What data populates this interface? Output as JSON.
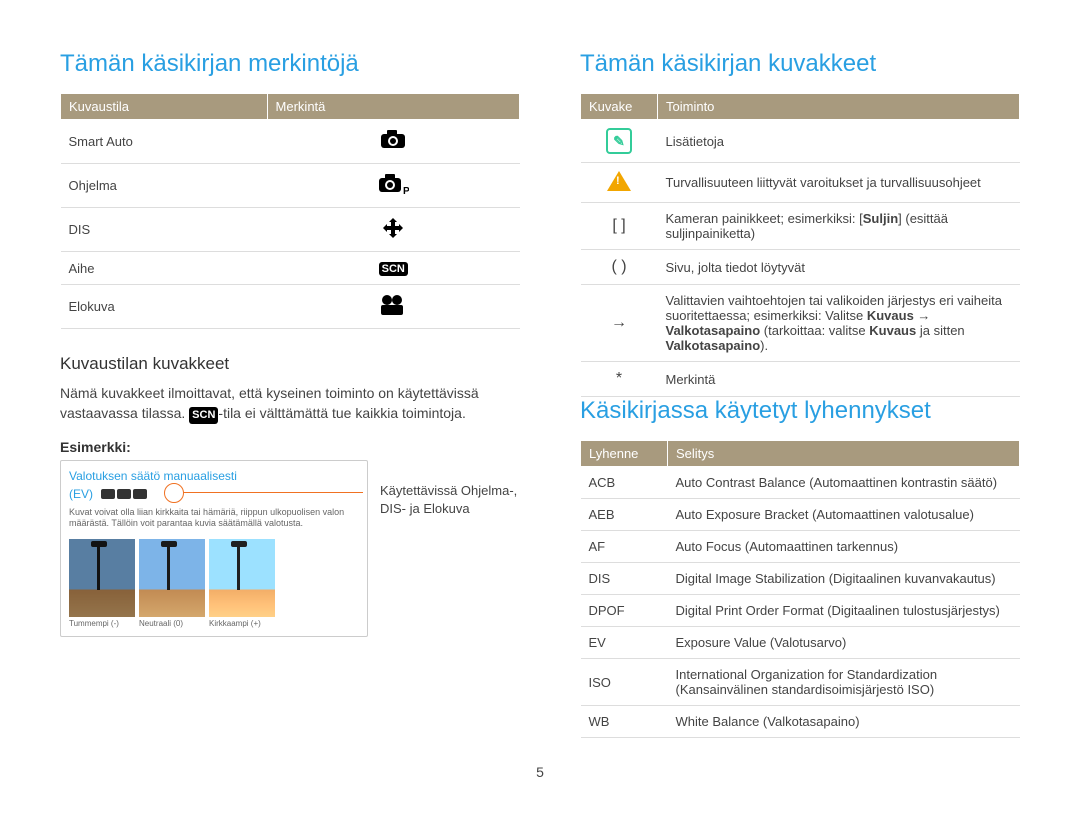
{
  "left": {
    "title": "Tämän käsikirjan merkintöjä",
    "table1": {
      "head_mode": "Kuvaustila",
      "head_mark": "Merkintä",
      "rows": [
        {
          "mode": "Smart Auto",
          "icon": "camera-smart-icon"
        },
        {
          "mode": "Ohjelma",
          "icon": "camera-p-icon"
        },
        {
          "mode": "DIS",
          "icon": "dis-icon"
        },
        {
          "mode": "Aihe",
          "icon": "scn-icon"
        },
        {
          "mode": "Elokuva",
          "icon": "video-icon"
        }
      ]
    },
    "sub1": "Kuvaustilan kuvakkeet",
    "body1a": "Nämä kuvakkeet ilmoittavat, että kyseinen toiminto on käytettävissä vastaavassa tilassa. ",
    "body1b": "-tila ei välttämättä tue kaikkia toimintoja.",
    "example_label": "Esimerkki:",
    "example": {
      "title": "Valotuksen säätö manuaalisesti",
      "ev": "(EV)",
      "desc": "Kuvat voivat olla liian kirkkaita tai hämäriä, riippun ulkopuolisen valon määrästä. Tällöin voit parantaa kuvia säätämällä valotusta.",
      "caps": [
        "Tummempi (-)",
        "Neutraali (0)",
        "Kirkkaampi (+)"
      ]
    },
    "right_note": "Käytettävissä Ohjelma-, DIS- ja Elokuva"
  },
  "right": {
    "title1": "Tämän käsikirjan kuvakkeet",
    "table2": {
      "head_icon": "Kuvake",
      "head_fn": "Toiminto",
      "rows": [
        {
          "sym": "info",
          "fn": "Lisätietoja"
        },
        {
          "sym": "warn",
          "fn": "Turvallisuuteen liittyvät varoitukset ja turvallisuusohjeet"
        },
        {
          "sym": "[ ]",
          "fn_html": "Kameran painikkeet; esimerkiksi: [<b>Suljin</b>] (esittää suljinpainiketta)"
        },
        {
          "sym": "( )",
          "fn": "Sivu, jolta tiedot löytyvät"
        },
        {
          "sym": "→",
          "fn_html": "Valittavien vaihtoehtojen tai valikoiden järjestys eri vaiheita suoritettaessa; esimerkiksi: Valitse <b>Kuvaus</b> → <b>Valkotasapaino</b> (tarkoittaa: valitse <b>Kuvaus</b> ja sitten <b>Valkotasapaino</b>)."
        },
        {
          "sym": "*",
          "fn": "Merkintä"
        }
      ]
    },
    "title2": "Käsikirjassa käytetyt lyhennykset",
    "table3": {
      "head_abbr": "Lyhenne",
      "head_expl": "Selitys",
      "rows": [
        {
          "abbr": "ACB",
          "expl": "Auto Contrast Balance (Automaattinen kontrastin säätö)"
        },
        {
          "abbr": "AEB",
          "expl": "Auto Exposure Bracket (Automaattinen valotusalue)"
        },
        {
          "abbr": "AF",
          "expl": "Auto Focus (Automaattinen tarkennus)"
        },
        {
          "abbr": "DIS",
          "expl": "Digital Image Stabilization (Digitaalinen kuvanvakautus)"
        },
        {
          "abbr": "DPOF",
          "expl": "Digital Print Order Format (Digitaalinen tulostusjärjestys)"
        },
        {
          "abbr": "EV",
          "expl": "Exposure Value (Valotusarvo)"
        },
        {
          "abbr": "ISO",
          "expl": "International Organization for Standardization (Kansainvälinen standardisoimisjärjestö ISO)"
        },
        {
          "abbr": "WB",
          "expl": "White Balance (Valkotasapaino)"
        }
      ]
    }
  },
  "page_number": "5"
}
